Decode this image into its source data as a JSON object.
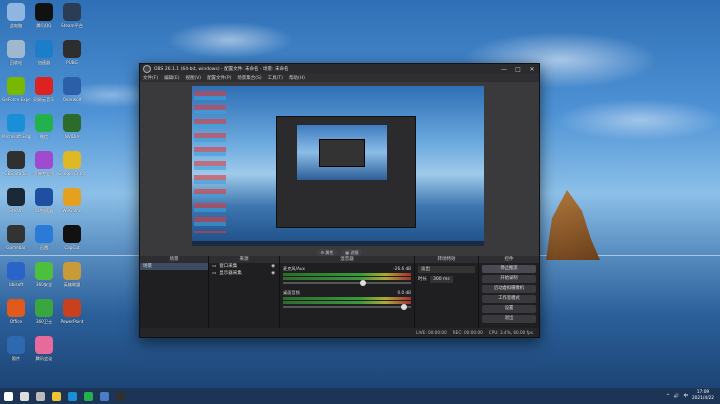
{
  "desktop": {
    "icons": [
      {
        "label": "此电脑",
        "color": "#8fb6e0"
      },
      {
        "label": "腾讯QQ",
        "color": "#111111"
      },
      {
        "label": "Steam平台",
        "color": "#2b3c55"
      },
      {
        "label": "回收站",
        "color": "#9fb8cf"
      },
      {
        "label": "加速器",
        "color": "#1c7ec9"
      },
      {
        "label": "PUBG",
        "color": "#2e2e2e"
      },
      {
        "label": "GeForce Experience",
        "color": "#76b900"
      },
      {
        "label": "网易云音乐",
        "color": "#d22"
      },
      {
        "label": "Overwolf",
        "color": "#2b5fa8"
      },
      {
        "label": "Microsoft Edge",
        "color": "#1a8fd8"
      },
      {
        "label": "微信",
        "color": "#22b14c"
      },
      {
        "label": "NVIDIA",
        "color": "#2d6b2d"
      },
      {
        "label": "OBS Studio",
        "color": "#303030"
      },
      {
        "label": "剪映专业版",
        "color": "#a04ad0"
      },
      {
        "label": "Google Chrome",
        "color": "#dfb826"
      },
      {
        "label": "Steam",
        "color": "#1b2838"
      },
      {
        "label": "UU加速器",
        "color": "#1f4fa0"
      },
      {
        "label": "WeGame",
        "color": "#e6a020"
      },
      {
        "label": "Gamebar",
        "color": "#333333"
      },
      {
        "label": "迅雷",
        "color": "#2a7ad8"
      },
      {
        "label": "CapCut",
        "color": "#111111"
      },
      {
        "label": "Ubisoft",
        "color": "#2b64c8"
      },
      {
        "label": "360安全",
        "color": "#4cbf3c"
      },
      {
        "label": "英雄联盟",
        "color": "#c89a3a"
      },
      {
        "label": "Office",
        "color": "#e05a1e"
      },
      {
        "label": "360卫士",
        "color": "#3aa640"
      },
      {
        "label": "PowerPoint",
        "color": "#c8401e"
      },
      {
        "label": "照片",
        "color": "#2e68b0"
      },
      {
        "label": "腾讯会议",
        "color": "#e86a9a"
      }
    ]
  },
  "obs": {
    "title": "OBS 26.1.1 (64-bit, windows) - 配置文件: 未命名 - 场景: 未命名",
    "window_controls": [
      "—",
      "□",
      "✕"
    ],
    "menu": [
      "文件(F)",
      "编辑(E)",
      "视图(V)",
      "配置文件(P)",
      "场景集合(S)",
      "工具(T)",
      "帮助(H)"
    ],
    "preview_buttons": [
      "⚙ 属性",
      "▦ 滤镜"
    ],
    "docks": {
      "scenes": {
        "title": "场景",
        "items": [
          "场景"
        ]
      },
      "sources": {
        "title": "来源",
        "items": [
          "窗口采集",
          "显示器采集"
        ]
      },
      "mixer": {
        "title": "混音器",
        "channels": [
          {
            "name": "麦克风/Aux",
            "db": "-26.6 dB"
          },
          {
            "name": "桌面音频",
            "db": "0.0 dB"
          }
        ]
      },
      "transitions": {
        "title": "转场特效",
        "type": "淡出",
        "duration_label": "时长",
        "duration": "300 ms"
      },
      "controls": {
        "title": "控件",
        "buttons": [
          "停止推流",
          "开始录制",
          "启动虚拟摄像机",
          "工作室模式",
          "设置",
          "退出"
        ]
      }
    },
    "statusbar": {
      "live": "LIVE: 00:00:00",
      "rec": "REC: 00:00:00",
      "cpu": "CPU: 3.4%, 60.00 fps"
    },
    "dock_foot_symbols": [
      "+",
      "−",
      "∧",
      "∨"
    ],
    "source_foot_symbols": [
      "+",
      "−",
      "⚙",
      "∧",
      "∨"
    ]
  },
  "taskbar": {
    "apps": [
      {
        "name": "start",
        "color": "#ffffff"
      },
      {
        "name": "search",
        "color": "#dddddd"
      },
      {
        "name": "taskview",
        "color": "#bbbbbb"
      },
      {
        "name": "explorer",
        "color": "#f1c232"
      },
      {
        "name": "edge",
        "color": "#1a8fd8"
      },
      {
        "name": "wechat",
        "color": "#22b14c"
      },
      {
        "name": "store",
        "color": "#4a7dc8"
      },
      {
        "name": "obs",
        "color": "#303030"
      }
    ],
    "tray_icons": [
      "^",
      "🔊",
      "中"
    ],
    "time": "17:09",
    "date": "2021/4/22"
  }
}
